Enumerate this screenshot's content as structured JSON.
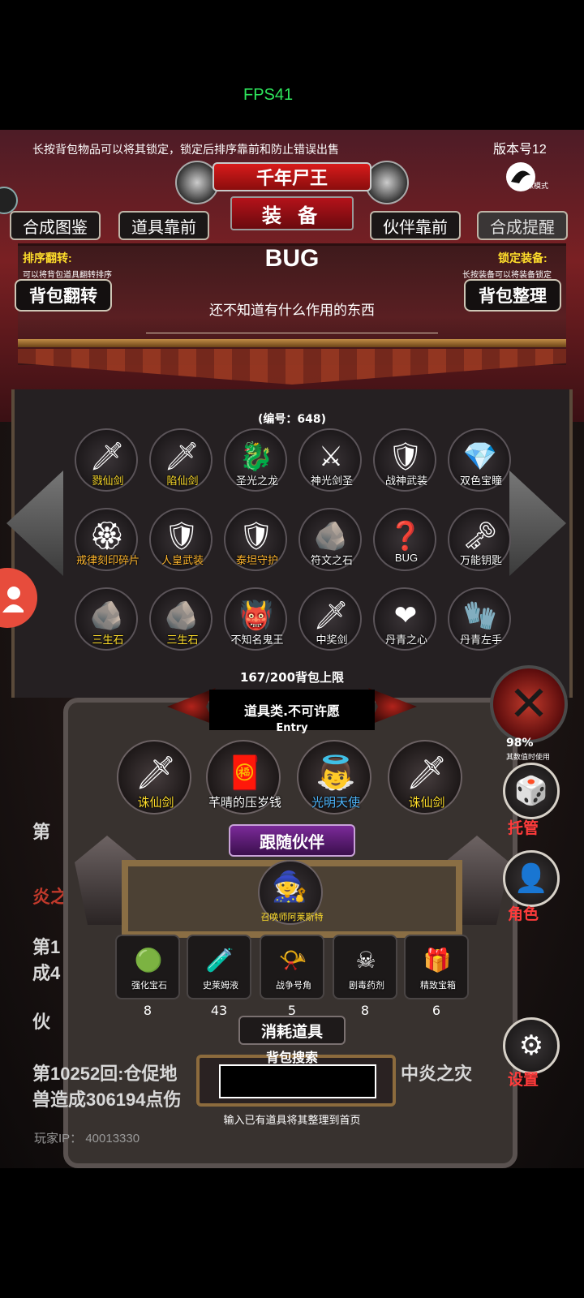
{
  "status": {
    "fps": "FPS41"
  },
  "header": {
    "tip": "长按背包物品可以将其锁定，锁定后排序靠前和防止错误出售",
    "version": "版本号12",
    "buff_mode": "炼狱模式",
    "title": "千年尸王",
    "subtitle": "装 备"
  },
  "tabs": [
    "合成图鉴",
    "道具靠前",
    "伙伴靠前",
    "合成提醒"
  ],
  "left_panel": {
    "label": "排序翻转:",
    "sub": "可以将背包道具翻转排序",
    "button": "背包翻转"
  },
  "right_panel": {
    "label": "锁定装备:",
    "sub": "长按装备可以将装备锁定",
    "button": "背包整理"
  },
  "selected_item": {
    "name": "BUG",
    "desc": "还不知道有什么作用的东西",
    "code": "(编号：648)"
  },
  "inventory": [
    {
      "label": "戮仙剑",
      "color": "yellow",
      "icon": "sword-icon"
    },
    {
      "label": "陷仙剑",
      "color": "yellow",
      "icon": "sword-icon"
    },
    {
      "label": "圣光之龙",
      "color": "white",
      "icon": "dragon-icon"
    },
    {
      "label": "神光剑圣",
      "color": "white",
      "icon": "knight-icon"
    },
    {
      "label": "战神武装",
      "color": "white",
      "icon": "armor-icon"
    },
    {
      "label": "双色宝瞳",
      "color": "white",
      "icon": "gem-icon"
    },
    {
      "label": "戒律刻印碎片",
      "color": "orange",
      "icon": "seal-icon"
    },
    {
      "label": "人皇武装",
      "color": "orange",
      "icon": "armor-icon"
    },
    {
      "label": "泰坦守护",
      "color": "orange",
      "icon": "shield-icon"
    },
    {
      "label": "符文之石",
      "color": "white",
      "icon": "rune-icon"
    },
    {
      "label": "BUG",
      "color": "white",
      "icon": "question-icon"
    },
    {
      "label": "万能钥匙",
      "color": "white",
      "icon": "key-icon"
    },
    {
      "label": "三生石",
      "color": "yellow",
      "icon": "stone-icon"
    },
    {
      "label": "三生石",
      "color": "yellow",
      "icon": "stone-icon"
    },
    {
      "label": "不知名鬼王",
      "color": "white",
      "icon": "ghost-icon"
    },
    {
      "label": "中奖剑",
      "color": "white",
      "icon": "sword-icon"
    },
    {
      "label": "丹青之心",
      "color": "white",
      "icon": "heart-icon"
    },
    {
      "label": "丹青左手",
      "color": "white",
      "icon": "hand-icon"
    }
  ],
  "capacity": "167/200背包上限",
  "entry": {
    "title": "道具类.不可许愿",
    "label": "Entry"
  },
  "entry_items": [
    {
      "label": "诛仙剑",
      "color": "yellow",
      "icon": "sword-icon"
    },
    {
      "label": "芊晴的压岁钱",
      "color": "white",
      "icon": "red-envelope-icon"
    },
    {
      "label": "光明天使",
      "color": "blue",
      "icon": "angel-icon"
    },
    {
      "label": "诛仙剑",
      "color": "yellow",
      "icon": "sword-icon"
    }
  ],
  "follow": {
    "title": "跟随伙伴",
    "pet_label": "召唤师阿莱斯特"
  },
  "consumables": [
    {
      "label": "强化宝石",
      "count": "8",
      "icon": "green-gem-icon"
    },
    {
      "label": "史莱姆液",
      "count": "43",
      "icon": "potion-icon"
    },
    {
      "label": "战争号角",
      "count": "5",
      "icon": "horn-icon"
    },
    {
      "label": "剧毒药剂",
      "count": "8",
      "icon": "poison-icon"
    },
    {
      "label": "精致宝箱",
      "count": "6",
      "icon": "chest-icon"
    }
  ],
  "consume_title": "消耗道具",
  "search": {
    "title": "背包搜索",
    "value": "",
    "hint": "输入已有道具将其整理到首页"
  },
  "right_buttons": {
    "manage": "托管",
    "role": "角色",
    "settings": "设置",
    "pct": "98%",
    "pct_sub": "其数值时使用"
  },
  "background_text": {
    "line1": "第",
    "line2": "炎之",
    "line3a": "第1",
    "line3b": "成4",
    "line4": "伙",
    "line5a": "第10252回:仓促地",
    "line5b": "中炎之灾",
    "line6": "兽造成306194点伤",
    "ip": "玩家IP： 40013330"
  },
  "colors": {
    "yellow": "#ffde2b",
    "orange": "#ffb62e",
    "blue": "#4fb8ff",
    "red_label": "#ff3b3b",
    "fps": "#2ee55c"
  }
}
